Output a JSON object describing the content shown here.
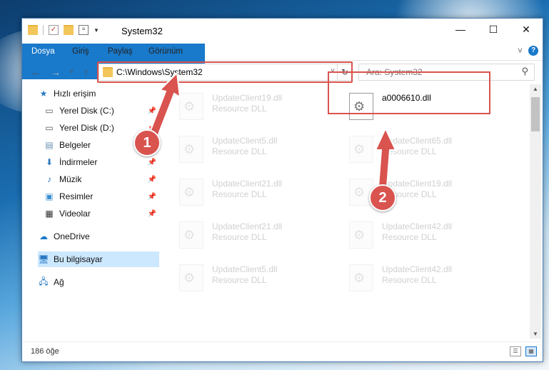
{
  "window": {
    "title": "System32",
    "minimize": "—",
    "maximize": "☐",
    "close": "✕"
  },
  "ribbon": {
    "tabs": [
      "Dosya",
      "Giriş",
      "Paylaş",
      "Görünüm"
    ],
    "collapse_caret": "˅",
    "help": "?"
  },
  "navbar": {
    "back": "←",
    "forward": "→",
    "recent": "˅",
    "up": "↑",
    "address": "C:\\Windows\\System32",
    "address_caret": "˅",
    "refresh": "↻",
    "search_placeholder": "Ara: System32",
    "search_icon": "⚲"
  },
  "sidebar": {
    "items": [
      {
        "label": "Hızlı erişim",
        "icon": "star-icon",
        "pinned": false
      },
      {
        "label": "Yerel Disk (C:)",
        "icon": "drive-icon",
        "pinned": true
      },
      {
        "label": "Yerel Disk (D:)",
        "icon": "drive-icon",
        "pinned": true
      },
      {
        "label": "Belgeler",
        "icon": "documents-icon",
        "pinned": true
      },
      {
        "label": "İndirmeler",
        "icon": "download-icon",
        "pinned": true
      },
      {
        "label": "Müzik",
        "icon": "music-icon",
        "pinned": true
      },
      {
        "label": "Resimler",
        "icon": "pictures-icon",
        "pinned": true
      },
      {
        "label": "Videolar",
        "icon": "video-icon",
        "pinned": true
      },
      {
        "label": "OneDrive",
        "icon": "cloud-icon",
        "pinned": false
      },
      {
        "label": "Bu bilgisayar",
        "icon": "computer-icon",
        "pinned": false,
        "selected": true
      },
      {
        "label": "Ağ",
        "icon": "network-icon",
        "pinned": false
      }
    ]
  },
  "files": {
    "target": {
      "name": "a0006610.dll",
      "type": ""
    },
    "left_column": [
      {
        "name": "UpdateClient19.dll",
        "type": "Resource DLL"
      },
      {
        "name": "UpdateClient5.dll",
        "type": "Resource DLL"
      },
      {
        "name": "UpdateClient21.dll",
        "type": "Resource DLL"
      },
      {
        "name": "UpdateClient21.dll",
        "type": "Resource DLL"
      },
      {
        "name": "UpdateClient5.dll",
        "type": "Resource DLL"
      }
    ],
    "right_column": [
      {
        "name": "UpdateClient65.dll",
        "type": "Resource DLL"
      },
      {
        "name": "UpdateClient19.dll",
        "type": "Resource DLL"
      },
      {
        "name": "UpdateClient42.dll",
        "type": "Resource DLL"
      },
      {
        "name": "UpdateClient42.dll",
        "type": "Resource DLL"
      }
    ]
  },
  "status": {
    "count": "186 öğe"
  },
  "callouts": [
    "1",
    "2"
  ],
  "colors": {
    "accent": "#1979ca",
    "highlight": "#d9534f",
    "selection": "#cce8ff"
  }
}
